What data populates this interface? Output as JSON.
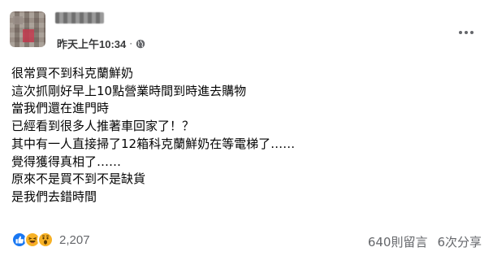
{
  "header": {
    "timestamp": "昨天上午10:34",
    "separator": "·",
    "privacy_icon": "globe-icon",
    "more_icon": "more-options-icon"
  },
  "post": {
    "lines": [
      "很常買不到科克蘭鮮奶",
      "這次抓剛好早上10點營業時間到時進去購物",
      "當我們還在進門時",
      "已經看到很多人推著車回家了！？",
      "其中有一人直接掃了12箱科克蘭鮮奶在等電梯了……",
      "覺得獲得真相了……",
      "原來不是買不到不是缺貨",
      "是我們去錯時間"
    ]
  },
  "footer": {
    "reactions": [
      "like-icon",
      "haha-icon",
      "wow-icon"
    ],
    "reaction_count": "2,207",
    "comments": "640則留言",
    "shares": "6次分享"
  },
  "colors": {
    "like": "#1877f2",
    "emoji_yellow": "#f7b125",
    "secondary_text": "#65676b"
  }
}
